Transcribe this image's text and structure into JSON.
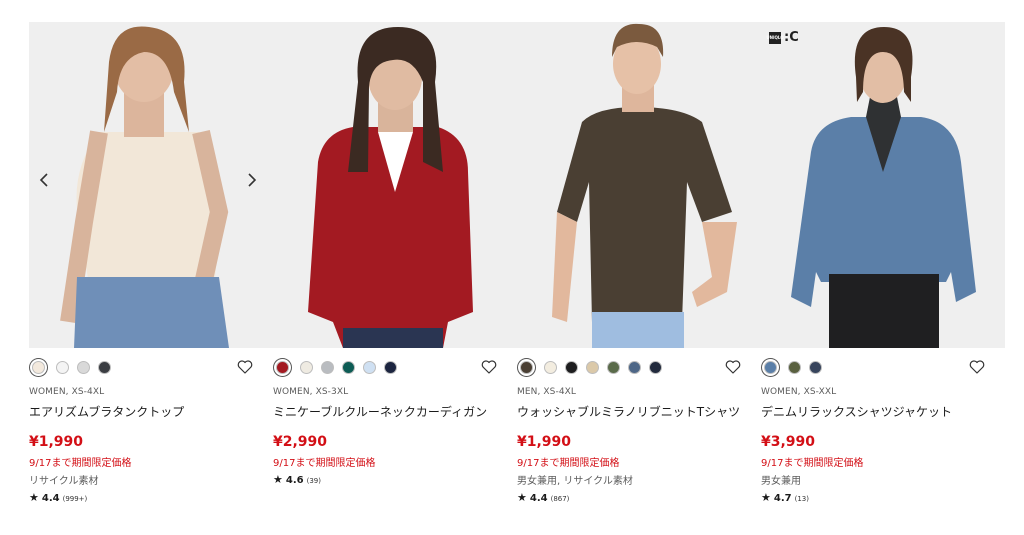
{
  "carousel": {
    "prev_icon": "chevron-left-icon",
    "next_icon": "chevron-right-icon"
  },
  "brand_logo": {
    "text": ":C",
    "box_text": "UNIQLO"
  },
  "products": [
    {
      "gender_size": "WOMEN, XS-4XL",
      "name": "エアリズムブラタンクトップ",
      "price": "¥1,990",
      "promo": "9/17まで期間限定価格",
      "note": "リサイクル素材",
      "rating": "4.4",
      "review_count": "(999+)",
      "swatches": [
        "#f3e9dd",
        "#f4f4f4",
        "#d9d9d9",
        "#3a3d42"
      ],
      "selected_swatch": 0
    },
    {
      "gender_size": "WOMEN, XS-3XL",
      "name": "ミニケーブルクルーネックカーディガン",
      "price": "¥2,990",
      "promo": "9/17まで期間限定価格",
      "note": "",
      "rating": "4.6",
      "review_count": "(39)",
      "swatches": [
        "#a31a22",
        "#efebe2",
        "#b9bcc0",
        "#0d5c55",
        "#cfe0f2",
        "#1c2540"
      ],
      "selected_swatch": 0
    },
    {
      "gender_size": "MEN, XS-4XL",
      "name": "ウォッシャブルミラノリブニットTシャツ",
      "price": "¥1,990",
      "promo": "9/17まで期間限定価格",
      "note": "男女兼用, リサイクル素材",
      "rating": "4.4",
      "review_count": "(867)",
      "swatches": [
        "#4a3f33",
        "#f3ede0",
        "#1d1d1f",
        "#dbc9a9",
        "#5a6b4a",
        "#4e6787",
        "#222a3d"
      ],
      "selected_swatch": 0
    },
    {
      "gender_size": "WOMEN, XS-XXL",
      "name": "デニムリラックスシャツジャケット",
      "price": "¥3,990",
      "promo": "9/17まで期間限定価格",
      "note": "男女兼用",
      "rating": "4.7",
      "review_count": "(13)",
      "swatches": [
        "#5b7fa8",
        "#59603f",
        "#37445c"
      ],
      "selected_swatch": 0
    }
  ],
  "colors": {
    "price_red": "#d30f16",
    "muted_text": "#5c5c5c"
  }
}
